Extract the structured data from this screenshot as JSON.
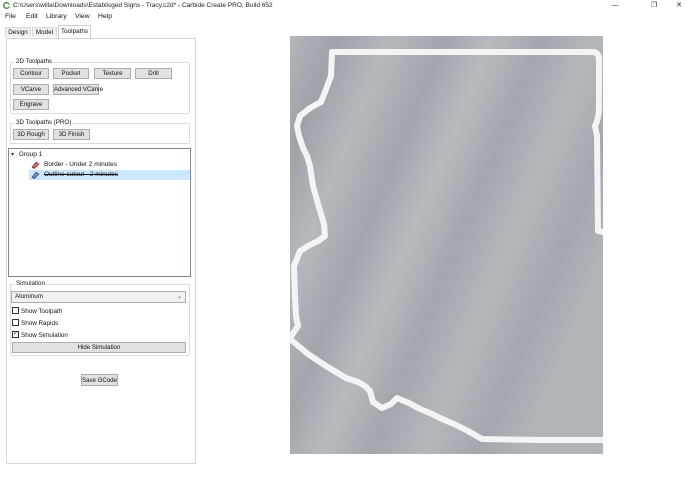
{
  "window": {
    "title": "C:\\Users\\willa\\Downloads\\Establisged Signs - Tracy.c2d* - Carbide Create PRO, Build 652",
    "minimize_glyph": "—",
    "maximize_glyph": "❐",
    "close_glyph": "✕"
  },
  "menu": [
    "File",
    "Edit",
    "Library",
    "View",
    "Help"
  ],
  "tabs": [
    {
      "label": "Design",
      "active": false
    },
    {
      "label": "Model",
      "active": false
    },
    {
      "label": "Toolpaths",
      "active": true
    }
  ],
  "toolpaths_2d": {
    "title": "2D Toolpaths",
    "buttons": [
      "Contour",
      "Pocket",
      "Texture",
      "Drill",
      "VCarve",
      "Advanced VCarve",
      "Engrave"
    ]
  },
  "toolpaths_3d": {
    "title": "3D Toolpaths (PRO)",
    "buttons": [
      "3D Rough",
      "3D Finish"
    ]
  },
  "tree": {
    "group_label": "Group 1",
    "items": [
      {
        "label": "Border - Under 2 minutes",
        "selected": false,
        "disabled": false
      },
      {
        "label": "Outline cutout - 2 minutes",
        "selected": true,
        "disabled": true
      }
    ]
  },
  "simulation": {
    "title": "Simulation",
    "material": "Aluminum",
    "show_toolpath": {
      "label": "Show Toolpath",
      "checked": false
    },
    "show_rapids": {
      "label": "Show Rapids",
      "checked": false
    },
    "show_simulation": {
      "label": "Show Simulation",
      "checked": true
    },
    "hide_button": "Hide Simulation"
  },
  "save_gcode": "Save GCode",
  "colors": {
    "stock": "#a9aeb3",
    "cut_path": "#f2f2f2",
    "selection": "#cce8ff"
  }
}
